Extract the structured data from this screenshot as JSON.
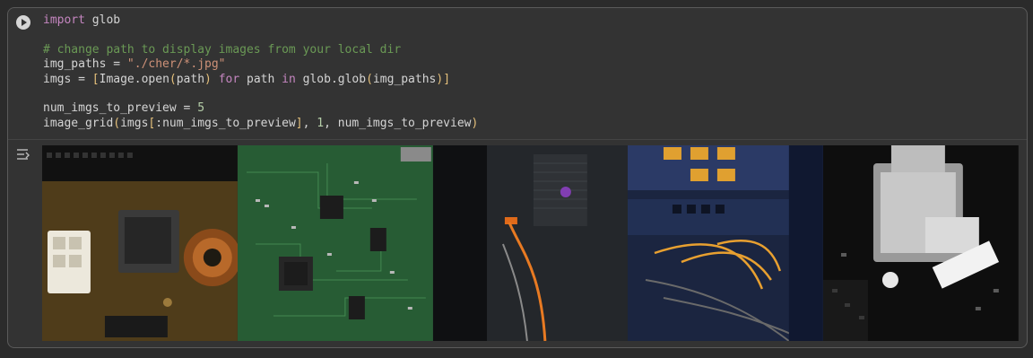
{
  "cell": {
    "run_button_icon": "play-circle-icon",
    "code_lines": [
      [
        {
          "t": "import",
          "c": "kw"
        },
        {
          "t": " glob",
          "c": ""
        }
      ],
      [],
      [
        {
          "t": "# change path to display images from your local dir",
          "c": "cm"
        }
      ],
      [
        {
          "t": "img_paths = ",
          "c": ""
        },
        {
          "t": "\"./cher/*.jpg\"",
          "c": "st"
        }
      ],
      [
        {
          "t": "imgs = ",
          "c": ""
        },
        {
          "t": "[",
          "c": "pb"
        },
        {
          "t": "Image.open",
          "c": ""
        },
        {
          "t": "(",
          "c": "pb"
        },
        {
          "t": "path",
          "c": ""
        },
        {
          "t": ")",
          "c": "pb"
        },
        {
          "t": " ",
          "c": ""
        },
        {
          "t": "for",
          "c": "kw"
        },
        {
          "t": " path ",
          "c": ""
        },
        {
          "t": "in",
          "c": "kw"
        },
        {
          "t": " glob.glob",
          "c": ""
        },
        {
          "t": "(",
          "c": "pb"
        },
        {
          "t": "img_paths",
          "c": ""
        },
        {
          "t": ")",
          "c": "pb"
        },
        {
          "t": "]",
          "c": "pb"
        }
      ],
      [],
      [
        {
          "t": "num_imgs_to_preview = ",
          "c": ""
        },
        {
          "t": "5",
          "c": "nm"
        }
      ],
      [
        {
          "t": "image_grid",
          "c": ""
        },
        {
          "t": "(",
          "c": "pb"
        },
        {
          "t": "imgs",
          "c": ""
        },
        {
          "t": "[",
          "c": "pb"
        },
        {
          "t": ":num_imgs_to_preview",
          "c": ""
        },
        {
          "t": "]",
          "c": "pb"
        },
        {
          "t": ", ",
          "c": ""
        },
        {
          "t": "1",
          "c": "nm"
        },
        {
          "t": ", num_imgs_to_preview",
          "c": ""
        },
        {
          "t": ")",
          "c": "pb"
        }
      ]
    ]
  },
  "output": {
    "toggle_icon": "output-toggle-icon",
    "images": [
      {
        "subject": "power-board-closeup",
        "bg": "#1e1a12"
      },
      {
        "subject": "green-circuit-board",
        "bg": "#1f4a2c"
      },
      {
        "subject": "server-cables-orange",
        "bg": "#15171a"
      },
      {
        "subject": "rack-network-cables",
        "bg": "#1b2540"
      },
      {
        "subject": "usb-port-monochrome",
        "bg": "#0e0e0e"
      }
    ]
  }
}
